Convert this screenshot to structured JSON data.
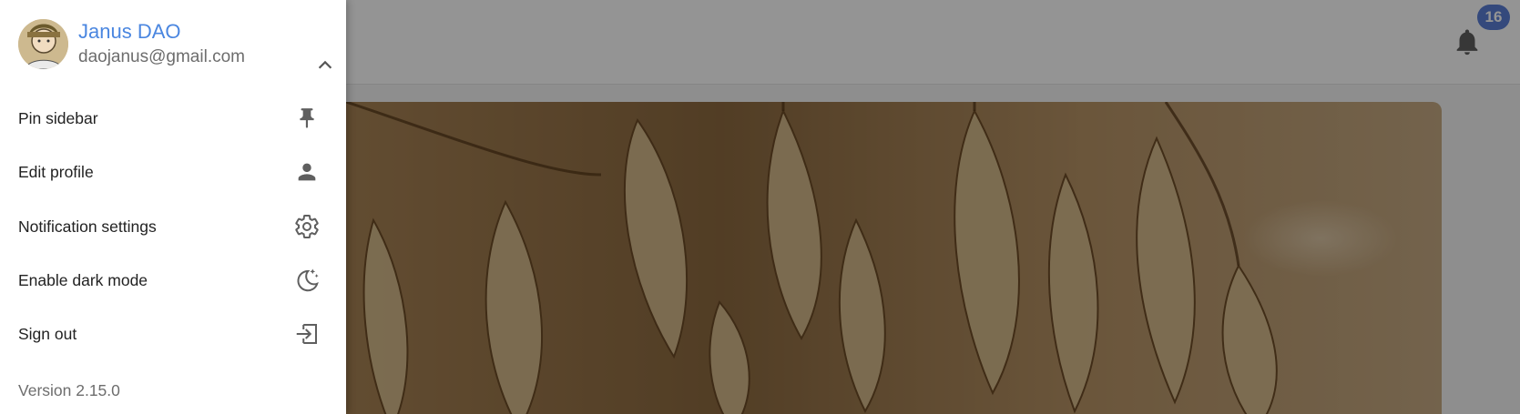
{
  "notifications": {
    "count": "16"
  },
  "profile": {
    "name": "Janus DAO",
    "email": "daojanus@gmail.com"
  },
  "menu": {
    "items": [
      {
        "label": "Pin sidebar",
        "icon": "pin-icon"
      },
      {
        "label": "Edit profile",
        "icon": "person-icon"
      },
      {
        "label": "Notification settings",
        "icon": "gear-icon"
      },
      {
        "label": "Enable dark mode",
        "icon": "moon-stars-icon"
      },
      {
        "label": "Sign out",
        "icon": "sign-out-icon"
      }
    ]
  },
  "version": "Version 2.15.0",
  "colors": {
    "accent": "#4a86e0",
    "badge": "#5b7fd6"
  }
}
